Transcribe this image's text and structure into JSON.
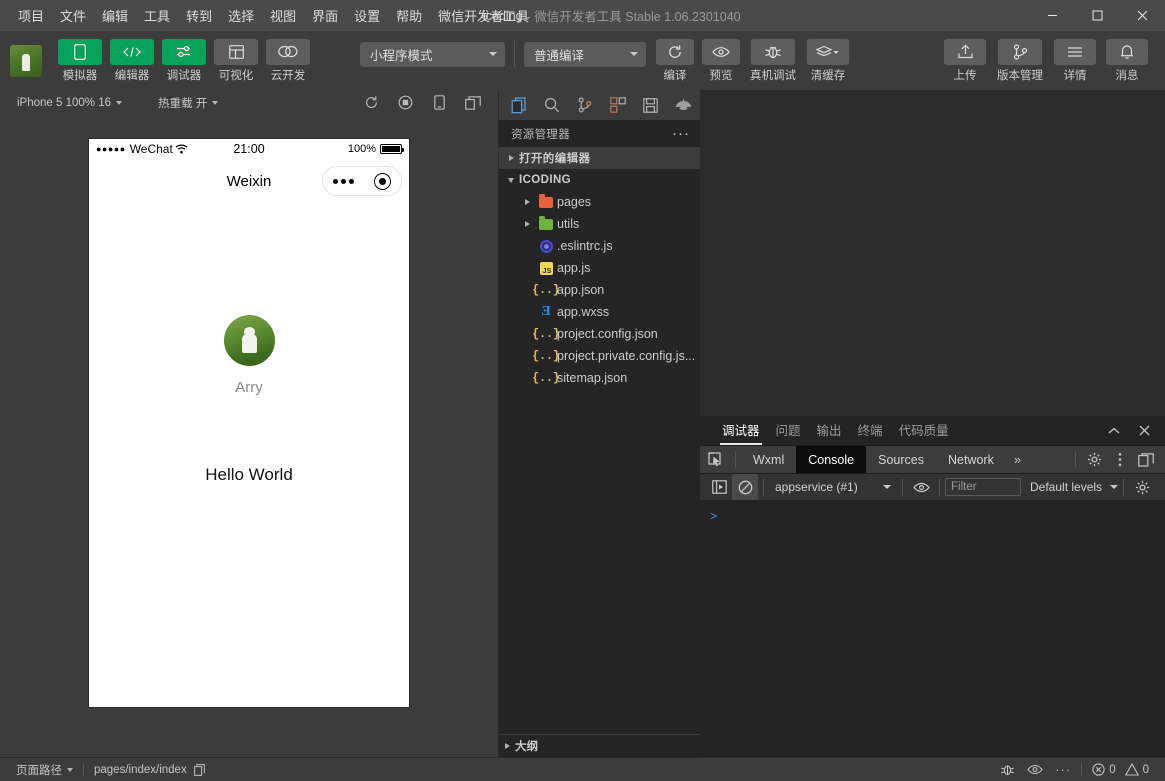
{
  "titlebar": {
    "menus": [
      "项目",
      "文件",
      "编辑",
      "工具",
      "转到",
      "选择",
      "视图",
      "界面",
      "设置",
      "帮助",
      "微信开发者工具"
    ],
    "project_name": "icoding",
    "app_title": "- 微信开发者工具 Stable 1.06.2301040",
    "window_controls": [
      "minimize-button",
      "maximize-button",
      "close-button"
    ]
  },
  "toolbar": {
    "left_buttons": [
      {
        "label": "模拟器",
        "icon": "phone-icon",
        "style": "green"
      },
      {
        "label": "编辑器",
        "icon": "code-icon",
        "style": "green"
      },
      {
        "label": "调试器",
        "icon": "sliders-icon",
        "style": "green"
      },
      {
        "label": "可视化",
        "icon": "layout-icon",
        "style": "grey"
      },
      {
        "label": "云开发",
        "icon": "cloud-icon",
        "style": "grey"
      }
    ],
    "mode_select": "小程序模式",
    "compile_select": "普通编译",
    "action_buttons": [
      {
        "label": "编译",
        "icon": "refresh-icon"
      },
      {
        "label": "预览",
        "icon": "eye-icon"
      },
      {
        "label": "真机调试",
        "icon": "bug-icon"
      },
      {
        "label": "清缓存",
        "icon": "layers-icon"
      }
    ],
    "right_buttons": [
      {
        "label": "上传",
        "icon": "upload-icon"
      },
      {
        "label": "版本管理",
        "icon": "branch-icon"
      },
      {
        "label": "详情",
        "icon": "menu-icon"
      },
      {
        "label": "消息",
        "icon": "bell-icon"
      }
    ]
  },
  "simulator": {
    "device_select": "iPhone 5 100% 16",
    "hot_reload": "热重载 开",
    "toolbar_icons": [
      "refresh-icon",
      "record-icon",
      "rotate-icon",
      "window-icon"
    ],
    "phone": {
      "status_dots": "●●●●●",
      "carrier": "WeChat",
      "wifi_icon": "wifi-icon",
      "time": "21:00",
      "battery_pct": "100%",
      "nav_title": "Weixin",
      "capsule_menu_icon": "more-dots-icon",
      "capsule_close_icon": "target-icon",
      "user_name": "Arry",
      "avatar": "user-avatar",
      "hello_text": "Hello World"
    }
  },
  "explorer": {
    "activity_icons": [
      "files-icon",
      "search-icon",
      "source-control-icon",
      "extensions-icon",
      "save-icon",
      "debug-console-icon"
    ],
    "title": "资源管理器",
    "more_icon": "ellipsis-icon",
    "open_editors": "打开的编辑器",
    "project_root": "ICODING",
    "files": [
      {
        "name": "pages",
        "type": "folder",
        "color": "#e8613c",
        "indent": 1
      },
      {
        "name": "utils",
        "type": "folder",
        "color": "#6cb33f",
        "indent": 1
      },
      {
        "name": ".eslintrc.js",
        "type": "eslint",
        "indent": 1
      },
      {
        "name": "app.js",
        "type": "js",
        "indent": 1
      },
      {
        "name": "app.json",
        "type": "json",
        "indent": 1
      },
      {
        "name": "app.wxss",
        "type": "wxss",
        "indent": 1
      },
      {
        "name": "project.config.json",
        "type": "json",
        "indent": 1
      },
      {
        "name": "project.private.config.js...",
        "type": "json",
        "indent": 1
      },
      {
        "name": "sitemap.json",
        "type": "json",
        "indent": 1
      }
    ],
    "outline": "大纲"
  },
  "devtools": {
    "panel_tabs": [
      {
        "label": "调试器",
        "active": true
      },
      {
        "label": "问题",
        "active": false
      },
      {
        "label": "输出",
        "active": false
      },
      {
        "label": "终端",
        "active": false
      },
      {
        "label": "代码质量",
        "active": false
      }
    ],
    "panel_controls": [
      "collapse-icon",
      "close-icon"
    ],
    "inspect_icon": "inspect-element-icon",
    "devtools_tabs": [
      {
        "label": "Wxml",
        "active": false
      },
      {
        "label": "Console",
        "active": true
      },
      {
        "label": "Sources",
        "active": false
      },
      {
        "label": "Network",
        "active": false
      }
    ],
    "more_tabs": "»",
    "right_icons": [
      "settings-gear-icon",
      "kebab-menu-icon",
      "dock-icon"
    ],
    "console": {
      "execute_icon": "sidebar-toggle-icon",
      "clear_icon": "clear-console-icon",
      "context": "appservice (#1)",
      "eye_icon": "live-expression-icon",
      "filter_placeholder": "Filter",
      "levels": "Default levels",
      "settings_icon": "console-settings-icon",
      "prompt": ">"
    }
  },
  "statusbar": {
    "page_path_label": "页面路径",
    "page_path": "pages/index/index",
    "copy_icon": "copy-icon",
    "right_icons": [
      "bug-icon",
      "eye-icon",
      "ellipsis-icon"
    ],
    "error_count": "0",
    "warning_count": "0"
  }
}
